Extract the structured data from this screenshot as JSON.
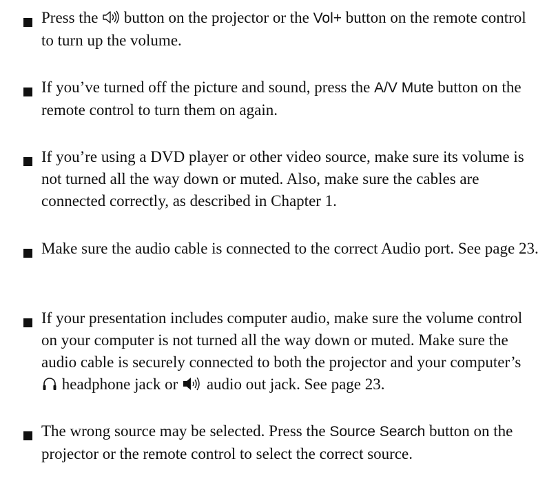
{
  "items": [
    {
      "pre": "Press the",
      "icon1": "volume-up-icon",
      "mid": "button on the projector or the",
      "kw": "Vol+",
      "post": "button on the remote control to turn up the volume."
    },
    {
      "pre": "If you’ve turned off the picture and sound, press the",
      "kw": "A/V Mute",
      "post": "button on the remote control to turn them on again."
    },
    {
      "text": "If you’re using a DVD player or other video source, make sure its volume is not turned all the way down or muted. Also, make sure the cables are connected correctly, as described in Chapter 1."
    },
    {
      "text": "Make sure the audio cable is connected to the correct Audio port. See page 23."
    },
    {
      "pre": "If your presentation includes computer audio, make sure the volume control on your computer is not turned all the way down or muted. Make sure the audio cable is securely connected to both the projector and your computer’s",
      "icon1": "headphone-icon",
      "mid": "headphone jack or",
      "icon2": "audio-out-icon",
      "post": "audio out jack. See page 23."
    },
    {
      "pre": "The wrong source may be selected. Press the",
      "kw": "Source Search",
      "post": "button on the projector or the remote control to select the correct source."
    }
  ]
}
